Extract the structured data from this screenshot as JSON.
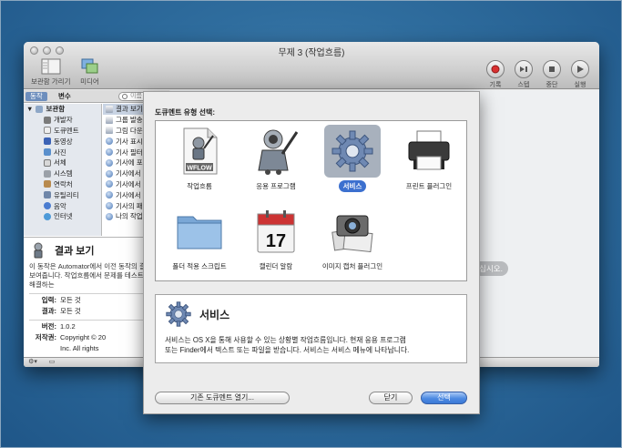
{
  "window": {
    "title": "무제 3 (작업흐름)",
    "toolbar_left": [
      "보관함 가리기",
      "미디어"
    ],
    "toolbar_right": [
      "기록",
      "스텝",
      "중단",
      "실행"
    ]
  },
  "left": {
    "tab_active": "동작",
    "tab_inactive": "변수",
    "search_placeholder": "이름",
    "library_header": "보관함",
    "library": [
      "개발자",
      "도큐멘트",
      "동영상",
      "사진",
      "서체",
      "시스템",
      "연락처",
      "유틸리티",
      "음악",
      "인터넷"
    ],
    "actions": [
      "결과 보기",
      "그룹 발송",
      "그림 다운",
      "기사 표시",
      "기사 필터",
      "기사에 포",
      "기사에서",
      "기사에서",
      "기사에서",
      "기사의 패",
      "나의 작업"
    ],
    "desc": {
      "title": "결과 보기",
      "text": "이 동작은 Automator에서 이전 동작의 결과를 보여줍니다. 작업흐름에서 문제를 테스트하고 해결하는",
      "input_label": "입력:",
      "input_value": "모든 것",
      "result_label": "결과:",
      "result_value": "모든 것",
      "version_label": "버전:",
      "version_value": "1.0.2",
      "copyright_label": "저작권:",
      "copyright_value": "Copyright © 20",
      "copyright_value2": "Inc.  All rights"
    }
  },
  "workflow": {
    "hint": "십시오."
  },
  "sheet": {
    "title": "도큐멘트 유형 선택:",
    "types": [
      {
        "label": "작업흐름",
        "icon": "workflow-doc-icon"
      },
      {
        "label": "응용 프로그램",
        "icon": "automator-robot-icon"
      },
      {
        "label": "서비스",
        "icon": "gear-icon"
      },
      {
        "label": "프린트 플러그인",
        "icon": "printer-icon"
      },
      {
        "label": "폴더 적용 스크립트",
        "icon": "folder-icon"
      },
      {
        "label": "캘린더 알람",
        "icon": "calendar-icon"
      },
      {
        "label": "이미지 캡처 플러그인",
        "icon": "camera-icon"
      }
    ],
    "calendar_day": "17",
    "workflow_badge": "WFLOW",
    "selected_index": 2,
    "info_title": "서비스",
    "info_text_1": "서비스는 OS X을 통해 사용할 수 있는 상황별 작업흐름입니다. 현재 응용 프로그램",
    "info_text_2": "또는 Finder에서 텍스트 또는 파일을 받습니다. 서비스는 서비스 메뉴에 나타납니다.",
    "open_existing": "기존 도큐멘트 열기...",
    "close": "닫기",
    "choose": "선택"
  },
  "colors": {
    "accent": "#3c70cf",
    "desktop": "#2f6d9e"
  }
}
